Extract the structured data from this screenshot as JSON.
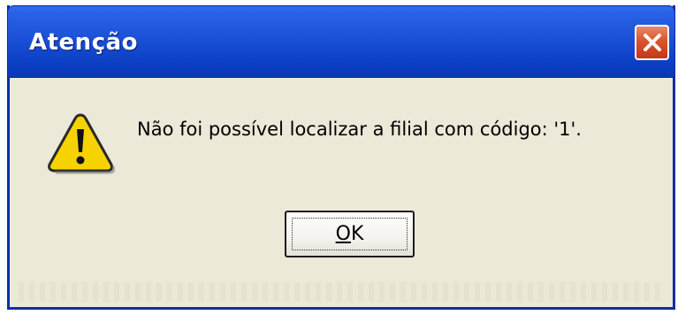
{
  "dialog": {
    "title": "Atenção",
    "message": "Não foi possível localizar a filial com código: '1'.",
    "ok_label_first": "O",
    "ok_label_rest": "K",
    "icon": "warning-icon",
    "close_icon": "close-icon"
  },
  "colors": {
    "titlebar": "#0b3fc4",
    "window_bg": "#ece9d8",
    "close_button": "#d9542e"
  }
}
